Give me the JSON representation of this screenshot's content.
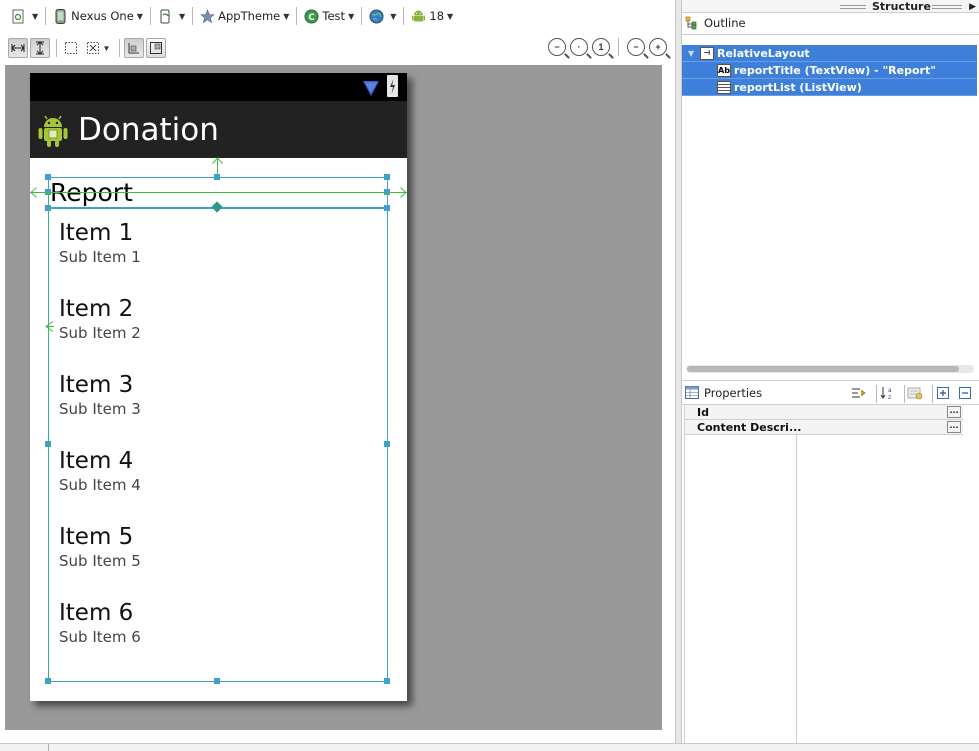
{
  "toolbar": {
    "device": "Nexus One",
    "theme": "AppTheme",
    "activity": "Test",
    "api_level": "18"
  },
  "device_preview": {
    "app_title": "Donation",
    "report_title": "Report",
    "items": [
      {
        "title": "Item 1",
        "subtitle": "Sub Item 1"
      },
      {
        "title": "Item 2",
        "subtitle": "Sub Item 2"
      },
      {
        "title": "Item 3",
        "subtitle": "Sub Item 3"
      },
      {
        "title": "Item 4",
        "subtitle": "Sub Item 4"
      },
      {
        "title": "Item 5",
        "subtitle": "Sub Item 5"
      },
      {
        "title": "Item 6",
        "subtitle": "Sub Item 6"
      }
    ]
  },
  "structure": {
    "title": "Structure",
    "outline_title": "Outline",
    "tree": [
      {
        "label": "RelativeLayout",
        "icon": "relativelayout-icon",
        "icon_text": "",
        "selected": true
      },
      {
        "label": "reportTitle (TextView) - \"Report\"",
        "icon": "textview-icon",
        "icon_text": "Ab",
        "selected": true
      },
      {
        "label": "reportList (ListView)",
        "icon": "listview-icon",
        "icon_text": "",
        "selected": true
      }
    ]
  },
  "properties": {
    "title": "Properties",
    "rows": [
      {
        "name": "Id",
        "value": ""
      },
      {
        "name": "Content Descri...",
        "value": ""
      }
    ],
    "button_label": "..."
  },
  "colors": {
    "selection": "#3d7fd9",
    "canvas": "#999999",
    "action_bar": "#222222",
    "guide": "#44bb44",
    "handle": "#3fa0d0"
  }
}
